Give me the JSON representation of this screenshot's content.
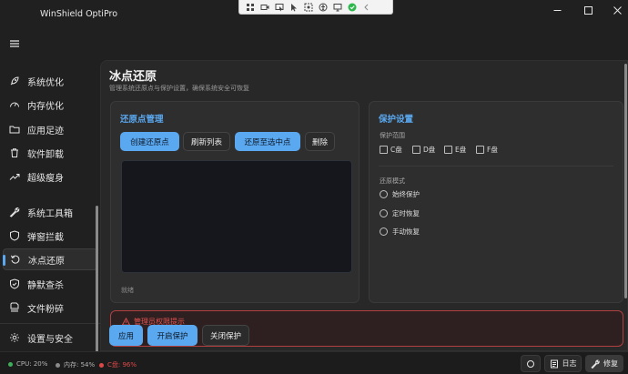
{
  "app": {
    "title": "WinShield OptiPro"
  },
  "sidebar": {
    "items": [
      {
        "label": "系统优化",
        "icon": "rocket-icon"
      },
      {
        "label": "内存优化",
        "icon": "gauge-icon"
      },
      {
        "label": "应用足迹",
        "icon": "folder-icon"
      },
      {
        "label": "软件卸载",
        "icon": "trash-icon"
      },
      {
        "label": "超级瘦身",
        "icon": "trend-up-icon"
      },
      {
        "label": "系统工具箱",
        "icon": "wrench-icon"
      },
      {
        "label": "弹窗拦截",
        "icon": "shield-icon"
      },
      {
        "label": "冰点还原",
        "icon": "restore-icon",
        "active": true
      },
      {
        "label": "静默查杀",
        "icon": "shield-check-icon"
      },
      {
        "label": "文件粉碎",
        "icon": "shredder-icon"
      }
    ],
    "settings": {
      "label": "设置与安全",
      "icon": "gear-icon"
    }
  },
  "page": {
    "title": "冰点还原",
    "subtitle": "管理系统还原点与保护设置，确保系统安全可恢复"
  },
  "restore_card": {
    "title": "还原点管理",
    "buttons": {
      "create": "创建还原点",
      "refresh": "刷新列表",
      "restore_selected": "还原至选中点",
      "delete": "删除"
    },
    "status": "就绪"
  },
  "protect_card": {
    "title": "保护设置",
    "range_label": "保护范围",
    "drives": [
      "C盘",
      "D盘",
      "E盘",
      "F盘"
    ],
    "mode_label": "还原模式",
    "modes": [
      "始终保护",
      "定时恢复",
      "手动恢复"
    ]
  },
  "warning": {
    "text": "管理员权限提示"
  },
  "actions": {
    "apply": "应用",
    "enable": "开启保护",
    "disable": "关闭保护"
  },
  "statusbar": {
    "cpu": "CPU: 20%",
    "memory": "内存: 54%",
    "c_drive": "C盘: 96%",
    "log": "日志",
    "repair": "修复",
    "colors": {
      "cpu": "#3fae5a",
      "memory": "#8a8a8a",
      "c_drive": "#e04848"
    }
  },
  "colors": {
    "accent": "#5aa8f0"
  }
}
